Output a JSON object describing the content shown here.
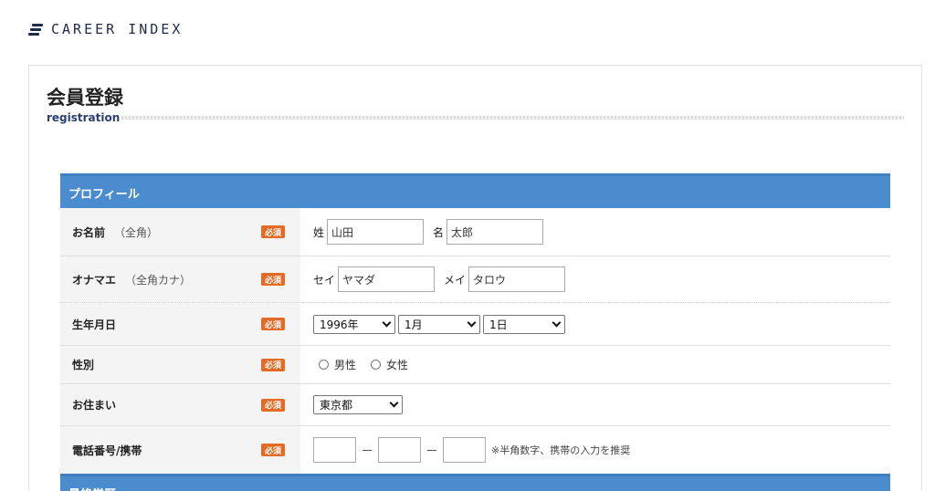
{
  "brand": {
    "name": "CAREER INDEX"
  },
  "page": {
    "title": "会員登録",
    "subtitle": "registration"
  },
  "colors": {
    "section_header": "#4a8ccd",
    "required_badge": "#e46a25",
    "label_bg": "#f4f4f4",
    "brand_text": "#1f2b4a"
  },
  "section_profile": {
    "title": "プロフィール"
  },
  "required_label": "必須",
  "rows": {
    "name": {
      "label": "お名前",
      "note": "（全角）",
      "sei_prefix": "姓",
      "sei_value": "山田",
      "mei_prefix": "名",
      "mei_value": "太郎"
    },
    "kana": {
      "label": "オナマエ",
      "note": "（全角カナ）",
      "sei_prefix": "セイ",
      "sei_value": "ヤマダ",
      "mei_prefix": "メイ",
      "mei_value": "タロウ"
    },
    "birthday": {
      "label": "生年月日",
      "year": "1996年",
      "month": "1月",
      "day": "1日"
    },
    "gender": {
      "label": "性別",
      "male": "男性",
      "female": "女性"
    },
    "address": {
      "label": "お住まい",
      "prefecture": "東京都"
    },
    "phone": {
      "label": "電話番号/携帯",
      "part1": "",
      "part2": "",
      "part3": "",
      "note": "※半角数字、携帯の入力を推奨"
    }
  },
  "section_next": {
    "title": "最終学歴"
  }
}
